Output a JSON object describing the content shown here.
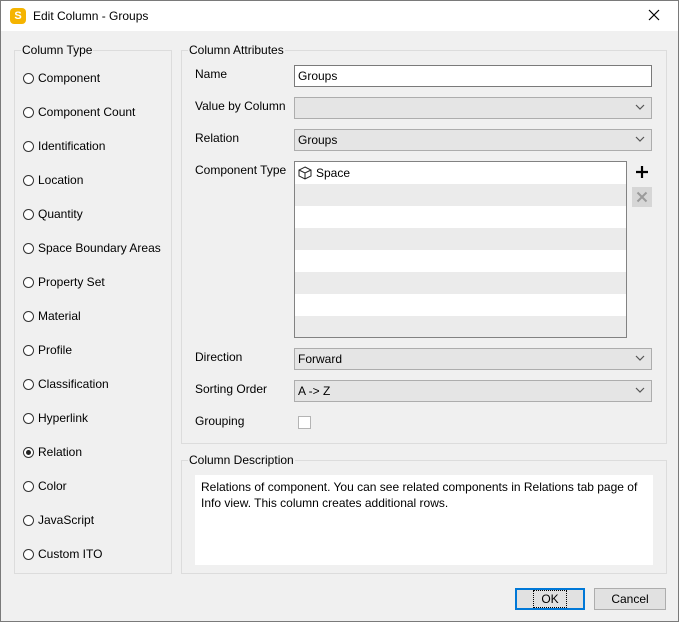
{
  "window": {
    "title": "Edit Column - Groups",
    "app_icon_letter": "S"
  },
  "column_type": {
    "label": "Column Type",
    "options": [
      {
        "label": "Component",
        "checked": false
      },
      {
        "label": "Component Count",
        "checked": false
      },
      {
        "label": "Identification",
        "checked": false
      },
      {
        "label": "Location",
        "checked": false
      },
      {
        "label": "Quantity",
        "checked": false
      },
      {
        "label": "Space Boundary Areas",
        "checked": false
      },
      {
        "label": "Property Set",
        "checked": false
      },
      {
        "label": "Material",
        "checked": false
      },
      {
        "label": "Profile",
        "checked": false
      },
      {
        "label": "Classification",
        "checked": false
      },
      {
        "label": "Hyperlink",
        "checked": false
      },
      {
        "label": "Relation",
        "checked": true
      },
      {
        "label": "Color",
        "checked": false
      },
      {
        "label": "JavaScript",
        "checked": false
      },
      {
        "label": "Custom ITO",
        "checked": false
      }
    ]
  },
  "attributes": {
    "label": "Column Attributes",
    "name_label": "Name",
    "name_value": "Groups",
    "value_by_column_label": "Value by Column",
    "value_by_column_value": "",
    "relation_label": "Relation",
    "relation_value": "Groups",
    "component_type_label": "Component Type",
    "component_types": [
      {
        "label": "Space",
        "icon": "cube-icon"
      }
    ],
    "direction_label": "Direction",
    "direction_value": "Forward",
    "sorting_order_label": "Sorting Order",
    "sorting_order_value": "A -> Z",
    "grouping_label": "Grouping",
    "grouping_checked": false
  },
  "description": {
    "label": "Column Description",
    "text": "Relations of component. You can see related components in Relations tab page of Info view. This column creates additional rows."
  },
  "buttons": {
    "ok": "OK",
    "cancel": "Cancel"
  }
}
